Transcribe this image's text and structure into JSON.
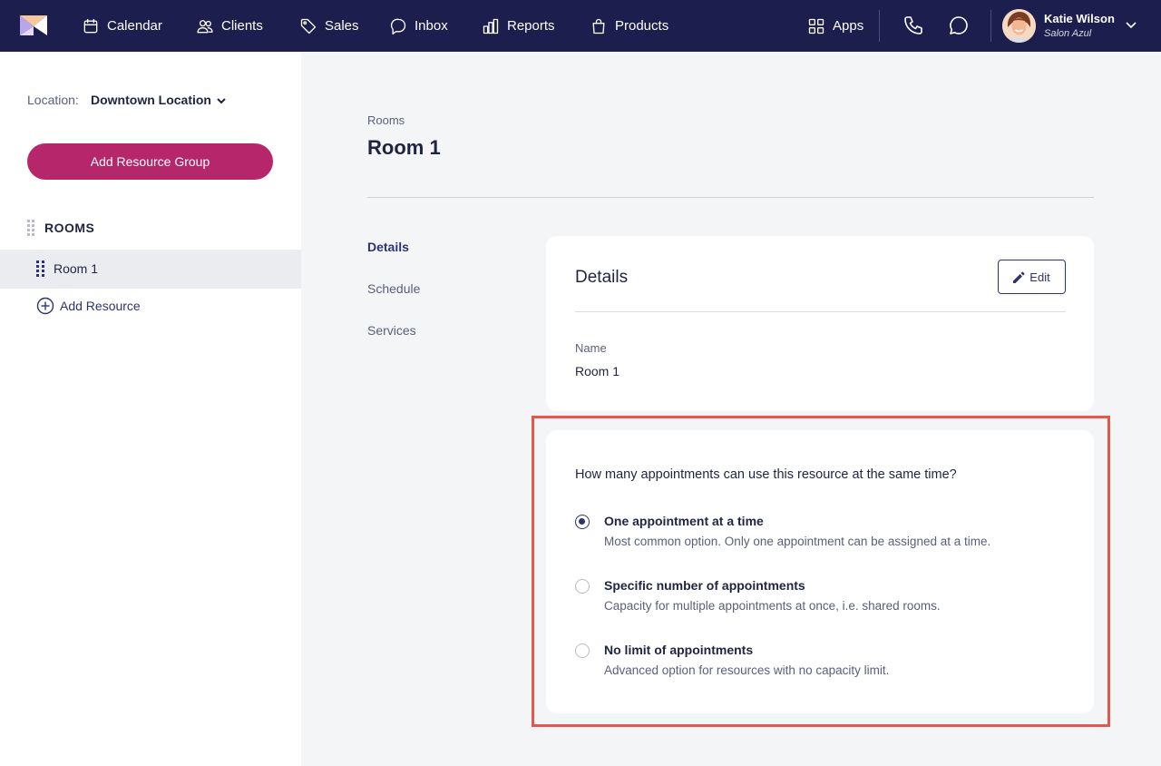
{
  "topbar": {
    "nav": [
      {
        "label": "Calendar",
        "icon": "calendar-icon"
      },
      {
        "label": "Clients",
        "icon": "users-icon"
      },
      {
        "label": "Sales",
        "icon": "tag-icon"
      },
      {
        "label": "Inbox",
        "icon": "chat-bubble-icon"
      },
      {
        "label": "Reports",
        "icon": "bar-chart-icon"
      },
      {
        "label": "Products",
        "icon": "shopping-bag-icon"
      }
    ],
    "apps_label": "Apps",
    "user": {
      "name": "Katie Wilson",
      "salon": "Salon Azul"
    }
  },
  "sidebar": {
    "location_label": "Location:",
    "location_value": "Downtown Location",
    "add_group_label": "Add Resource Group",
    "group_title": "ROOMS",
    "items": [
      {
        "label": "Room 1"
      }
    ],
    "add_resource_label": "Add Resource"
  },
  "main": {
    "breadcrumb": "Rooms",
    "title": "Room 1",
    "subnav": [
      "Details",
      "Schedule",
      "Services"
    ],
    "details_card": {
      "title": "Details",
      "edit_label": "Edit",
      "name_label": "Name",
      "name_value": "Room 1"
    },
    "capacity_card": {
      "question": "How many appointments can use this resource at the same time?",
      "options": [
        {
          "title": "One appointment at a time",
          "desc": "Most common option. Only one appointment can be assigned at a time.",
          "selected": true
        },
        {
          "title": "Specific number of appointments",
          "desc": "Capacity for multiple appointments at once, i.e. shared rooms.",
          "selected": false
        },
        {
          "title": "No limit of appointments",
          "desc": "Advanced option for resources with no capacity limit.",
          "selected": false
        }
      ]
    }
  },
  "colors": {
    "nav_bg": "#1c1f4d",
    "primary_button": "#b5266b",
    "accent": "#2d3372",
    "highlight_border": "#e5574b"
  }
}
